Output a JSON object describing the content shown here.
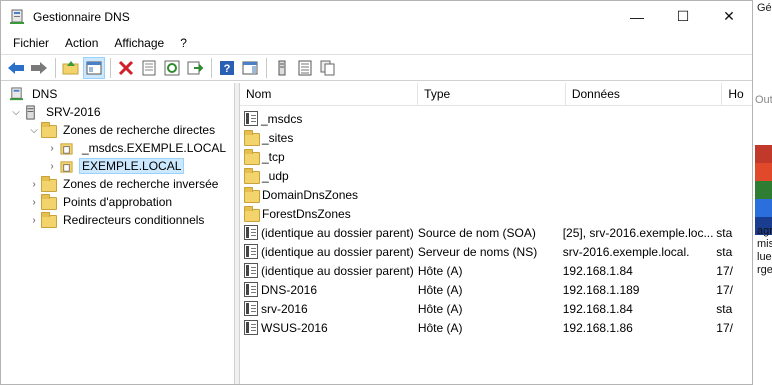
{
  "window": {
    "title": "Gestionnaire DNS",
    "controls": {
      "minimize": "—",
      "maximize": "☐",
      "close": "✕"
    }
  },
  "menu": [
    "Fichier",
    "Action",
    "Affichage",
    "?"
  ],
  "toolbar": {
    "icons": [
      "back-icon",
      "forward-icon",
      "up-folder-icon",
      "show-tree-icon",
      "delete-icon",
      "properties-icon",
      "refresh-icon",
      "export-icon",
      "help-icon",
      "show-action-pane-icon",
      "server-record-icon",
      "list-view-icon",
      "copy-icon"
    ]
  },
  "tree": {
    "root": "DNS",
    "server": "SRV-2016",
    "forward_zones": "Zones de recherche directes",
    "zone_msdcs": "_msdcs.EXEMPLE.LOCAL",
    "zone_exemple": "EXEMPLE.LOCAL",
    "reverse_zones": "Zones de recherche inversée",
    "trust_points": "Points d'approbation",
    "conditional_forwarders": "Redirecteurs conditionnels"
  },
  "list": {
    "columns": [
      "Nom",
      "Type",
      "Données",
      "Ho"
    ],
    "rows": [
      {
        "icon": "record",
        "name": "_msdcs",
        "type": "",
        "data": "",
        "extra": ""
      },
      {
        "icon": "folder",
        "name": "_sites",
        "type": "",
        "data": "",
        "extra": ""
      },
      {
        "icon": "folder",
        "name": "_tcp",
        "type": "",
        "data": "",
        "extra": ""
      },
      {
        "icon": "folder",
        "name": "_udp",
        "type": "",
        "data": "",
        "extra": ""
      },
      {
        "icon": "folder",
        "name": "DomainDnsZones",
        "type": "",
        "data": "",
        "extra": ""
      },
      {
        "icon": "folder",
        "name": "ForestDnsZones",
        "type": "",
        "data": "",
        "extra": ""
      },
      {
        "icon": "record",
        "name": "(identique au dossier parent)",
        "type": "Source de nom (SOA)",
        "data": "[25], srv-2016.exemple.loc...",
        "extra": "sta"
      },
      {
        "icon": "record",
        "name": "(identique au dossier parent)",
        "type": "Serveur de noms (NS)",
        "data": "srv-2016.exemple.local.",
        "extra": "sta"
      },
      {
        "icon": "record",
        "name": "(identique au dossier parent)",
        "type": "Hôte (A)",
        "data": "192.168.1.84",
        "extra": "17/"
      },
      {
        "icon": "record",
        "name": "DNS-2016",
        "type": "Hôte (A)",
        "data": "192.168.1.189",
        "extra": "17/"
      },
      {
        "icon": "record",
        "name": "srv-2016",
        "type": "Hôte (A)",
        "data": "192.168.1.84",
        "extra": "sta"
      },
      {
        "icon": "record",
        "name": "WSUS-2016",
        "type": "Hôte (A)",
        "data": "192.168.1.86",
        "extra": "17/"
      }
    ]
  },
  "background_window": {
    "top_text": "Gére",
    "mid_text": "Out",
    "bottom_lines": [
      "agr",
      "mis",
      "lue",
      "rge"
    ]
  },
  "colors": {
    "selection": "#cce8ff",
    "selection_border": "#99d1ff",
    "folder": "#f3d36c"
  }
}
